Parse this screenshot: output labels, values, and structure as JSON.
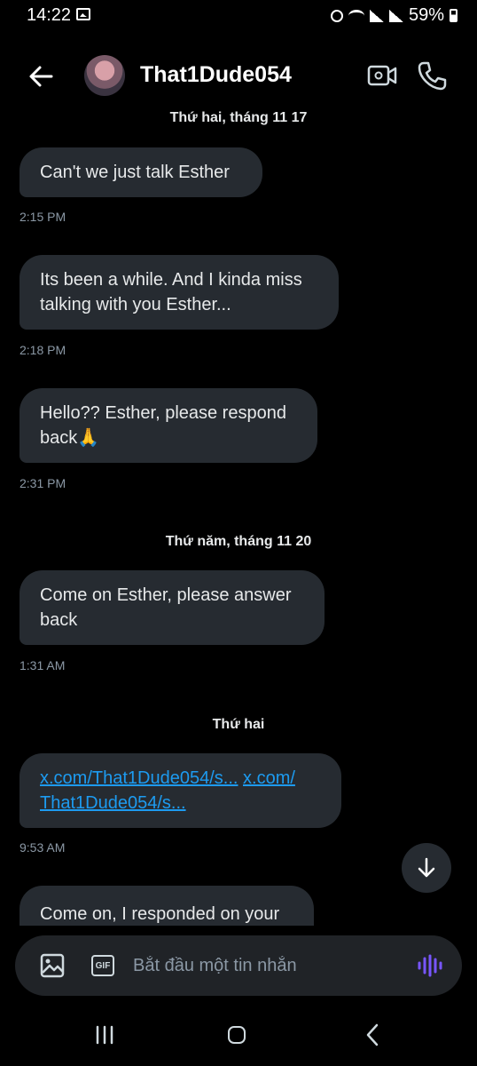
{
  "status_bar": {
    "time": "14:22",
    "battery": "59%"
  },
  "header": {
    "contact_name": "That1Dude054"
  },
  "date_separators": [
    "Thứ hai, tháng 11 17",
    "Thứ năm, tháng 11 20",
    "Thứ hai"
  ],
  "messages": [
    {
      "lines": [
        "Can't we just talk Esther"
      ],
      "time": "2:15 PM"
    },
    {
      "lines": [
        "Its been a while. And I kinda miss",
        "talking with you Esther..."
      ],
      "time": "2:18 PM"
    },
    {
      "lines": [
        "Hello?? Esther, please respond",
        "back🙏"
      ],
      "time": "2:31 PM"
    },
    {
      "lines": [
        "Come on Esther, please answer",
        "back"
      ],
      "time": "1:31 AM"
    },
    {
      "links": [
        "x.com/That1Dude054/s...",
        "x.com/",
        "That1Dude054/s..."
      ],
      "time": "9:53 AM"
    },
    {
      "lines": [
        "Come on, I responded on your"
      ]
    }
  ],
  "composer": {
    "placeholder": "Bắt đầu một tin nhắn",
    "gif_label": "GIF"
  },
  "icons": {
    "back": "back-arrow-icon",
    "video": "video-call-icon",
    "phone": "phone-call-icon",
    "image": "image-icon",
    "gif": "gif-icon",
    "voice": "voice-message-icon",
    "scroll_down": "arrow-down-icon"
  },
  "colors": {
    "bubble": "#262b31",
    "link": "#1d9bf0",
    "voice_accent": "#7856ff",
    "background": "#000000"
  }
}
